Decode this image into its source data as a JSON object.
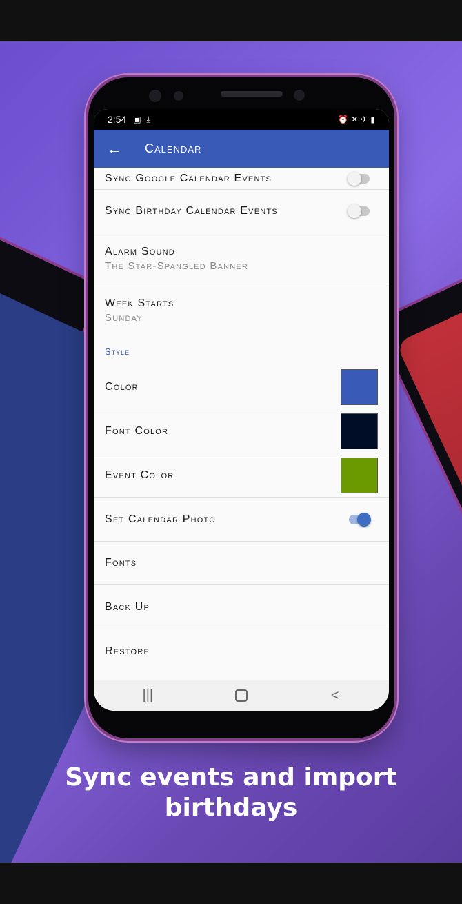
{
  "status_bar": {
    "time": "2:54",
    "left_icons": [
      "image-icon",
      "download-icon"
    ],
    "right_icons": [
      "alarm-icon",
      "mute-icon",
      "airplane-icon",
      "battery-icon"
    ]
  },
  "app_bar": {
    "title": "Calendar"
  },
  "settings": [
    {
      "label": "Sync Google Calendar Events",
      "toggle": false
    },
    {
      "label": "Sync Birthday Calendar Events",
      "toggle": false
    },
    {
      "label": "Alarm Sound",
      "value": "The Star-Spangled Banner"
    },
    {
      "label": "Week Starts",
      "value": "Sunday"
    }
  ],
  "style_section": {
    "header": "Style",
    "color": {
      "label": "Color",
      "swatch": "#3a5ab8"
    },
    "font_color": {
      "label": "Font Color",
      "swatch": "#000d26"
    },
    "event_color": {
      "label": "Event Color",
      "swatch": "#6a9a00"
    },
    "photo": {
      "label": "Set Calendar Photo",
      "toggle": true
    },
    "fonts": {
      "label": "Fonts"
    },
    "backup": {
      "label": "Back Up"
    },
    "restore": {
      "label": "Restore"
    }
  },
  "nav_bar": {
    "recents": "|||",
    "home": "",
    "back": "<"
  },
  "caption": {
    "line1": "Sync events and import",
    "line2": "birthdays"
  },
  "colors": {
    "background": "#7a5ad8",
    "accent": "#3a5ab8"
  }
}
